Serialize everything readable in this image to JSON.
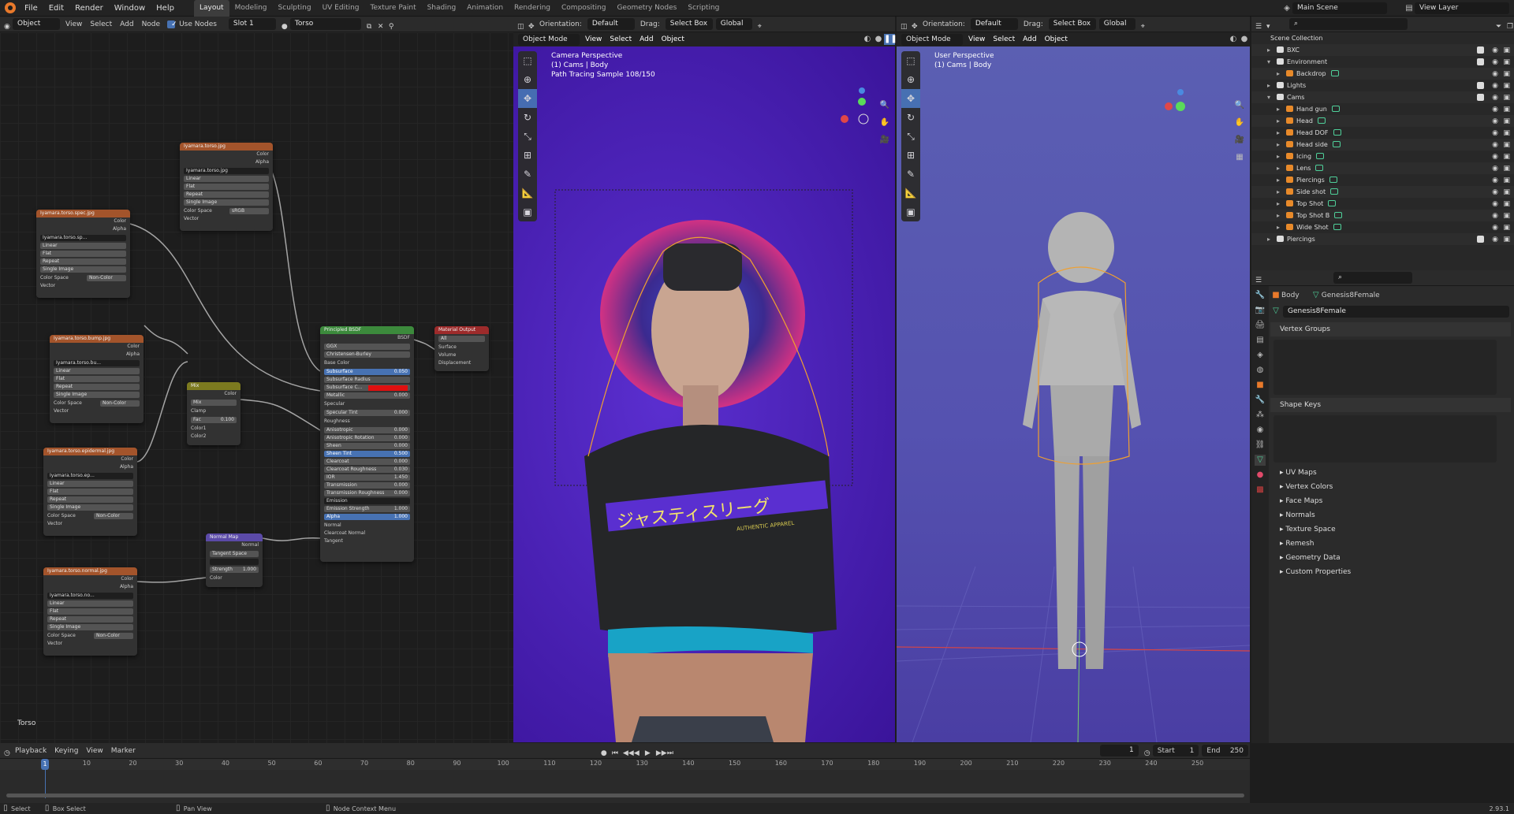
{
  "topbar": {
    "menus": [
      "File",
      "Edit",
      "Render",
      "Window",
      "Help"
    ],
    "workspaces": [
      "Layout",
      "Modeling",
      "Sculpting",
      "UV Editing",
      "Texture Paint",
      "Shading",
      "Animation",
      "Rendering",
      "Compositing",
      "Geometry Nodes",
      "Scripting"
    ],
    "active_ws": "Layout",
    "scene": "Main Scene",
    "view_layer": "View Layer"
  },
  "nodeheader": {
    "mode": "Object",
    "menus": [
      "View",
      "Select",
      "Add",
      "Node"
    ],
    "use_nodes": "Use Nodes",
    "slot": "Slot 1",
    "material": "Torso"
  },
  "nodes": {
    "tex_torso": {
      "title": "Iyamara.torso.jpg",
      "img": "Iyamara.torso.jpg",
      "interp": "Linear",
      "proj": "Flat",
      "ext": "Repeat",
      "src": "Single Image",
      "cs_label": "Color Space",
      "cs": "sRGB",
      "out_color": "Color",
      "out_alpha": "Alpha",
      "in_vec": "Vector"
    },
    "tex_spec": {
      "title": "Iyamara.torso.spec.jpg",
      "img": "Iyamara.torso.sp...",
      "interp": "Linear",
      "proj": "Flat",
      "ext": "Repeat",
      "src": "Single Image",
      "cs_label": "Color Space",
      "cs": "Non-Color",
      "out_color": "Color",
      "out_alpha": "Alpha",
      "in_vec": "Vector"
    },
    "tex_bump": {
      "title": "Iyamara.torso.bump.jpg",
      "img": "Iyamara.torso.bu...",
      "interp": "Linear",
      "proj": "Flat",
      "ext": "Repeat",
      "src": "Single Image",
      "cs_label": "Color Space",
      "cs": "Non-Color",
      "out_color": "Color",
      "out_alpha": "Alpha",
      "in_vec": "Vector"
    },
    "tex_epi": {
      "title": "Iyamara.torso.epidermal.jpg",
      "img": "Iyamara.torso.ep...",
      "interp": "Linear",
      "proj": "Flat",
      "ext": "Repeat",
      "src": "Single Image",
      "cs_label": "Color Space",
      "cs": "Non-Color",
      "out_color": "Color",
      "out_alpha": "Alpha",
      "in_vec": "Vector"
    },
    "tex_normal": {
      "title": "Iyamara.torso.normal.jpg",
      "img": "Iyamara.torso.no...",
      "interp": "Linear",
      "proj": "Flat",
      "ext": "Repeat",
      "src": "Single Image",
      "cs_label": "Color Space",
      "cs": "Non-Color",
      "out_color": "Color",
      "out_alpha": "Alpha",
      "in_vec": "Vector"
    },
    "mix": {
      "title": "Mix",
      "out": "Color",
      "mode": "Mix",
      "clamp": "Clamp",
      "fac": "Fac",
      "fac_val": "0.100",
      "c1": "Color1",
      "c2": "Color2"
    },
    "normalmap": {
      "title": "Normal Map",
      "out": "Normal",
      "space": "Tangent Space",
      "strength": "Strength",
      "strength_val": "1.000",
      "color": "Color"
    },
    "bsdf": {
      "title": "Principled BSDF",
      "out": "BSDF",
      "dist": "GGX",
      "sss": "Christensen-Burley",
      "rows": [
        [
          "Base Color",
          ""
        ],
        [
          "Subsurface",
          "0.050"
        ],
        [
          "Subsurface Radius",
          ""
        ],
        [
          "Subsurface C...",
          ""
        ],
        [
          "Metallic",
          "0.000"
        ],
        [
          "Specular",
          ""
        ],
        [
          "Specular Tint",
          "0.000"
        ],
        [
          "Roughness",
          ""
        ],
        [
          "Anisotropic",
          "0.000"
        ],
        [
          "Anisotropic Rotation",
          "0.000"
        ],
        [
          "Sheen",
          "0.000"
        ],
        [
          "Sheen Tint",
          "0.500"
        ],
        [
          "Clearcoat",
          "0.000"
        ],
        [
          "Clearcoat Roughness",
          "0.030"
        ],
        [
          "IOR",
          "1.450"
        ],
        [
          "Transmission",
          "0.000"
        ],
        [
          "Transmission Roughness",
          "0.000"
        ],
        [
          "Emission",
          ""
        ],
        [
          "Emission Strength",
          "1.000"
        ],
        [
          "Alpha",
          "1.000"
        ],
        [
          "Normal",
          ""
        ],
        [
          "Clearcoat Normal",
          ""
        ],
        [
          "Tangent",
          ""
        ]
      ]
    },
    "out": {
      "title": "Material Output",
      "target": "All",
      "surface": "Surface",
      "volume": "Volume",
      "disp": "Displacement"
    }
  },
  "node_label": "Torso",
  "vp1": {
    "mode": "Object Mode",
    "menus": [
      "View",
      "Select",
      "Add",
      "Object"
    ],
    "orientation_label": "Orientation:",
    "orientation": "Default",
    "drag_label": "Drag:",
    "drag": "Select Box",
    "transform": "Global",
    "line1": "Camera Perspective",
    "line2": "(1) Cams | Body",
    "line3": "Path Tracing Sample 108/150",
    "shirt_text": "ジャスティスリーグ",
    "shirt_sub": "AUTHENTIC APPAREL"
  },
  "vp2": {
    "mode": "Object Mode",
    "menus": [
      "View",
      "Select",
      "Add",
      "Object"
    ],
    "orientation_label": "Orientation:",
    "orientation": "Default",
    "drag_label": "Drag:",
    "drag": "Select Box",
    "transform": "Global",
    "line1": "User Perspective",
    "line2": "(1) Cams | Body"
  },
  "outliner": {
    "root": "Scene Collection",
    "items": [
      {
        "label": "BXC",
        "indent": 1,
        "arrow": "▸"
      },
      {
        "label": "Environment",
        "indent": 1,
        "arrow": "▾"
      },
      {
        "label": "Backdrop",
        "indent": 2,
        "arrow": "▸"
      },
      {
        "label": "Lights",
        "indent": 1,
        "arrow": "▸"
      },
      {
        "label": "Cams",
        "indent": 1,
        "arrow": "▾"
      },
      {
        "label": "Hand gun",
        "indent": 2,
        "arrow": "▸"
      },
      {
        "label": "Head",
        "indent": 2,
        "arrow": "▸"
      },
      {
        "label": "Head DOF",
        "indent": 2,
        "arrow": "▸"
      },
      {
        "label": "Head side",
        "indent": 2,
        "arrow": "▸"
      },
      {
        "label": "Icing",
        "indent": 2,
        "arrow": "▸"
      },
      {
        "label": "Lens",
        "indent": 2,
        "arrow": "▸"
      },
      {
        "label": "Piercings",
        "indent": 2,
        "arrow": "▸"
      },
      {
        "label": "Side shot",
        "indent": 2,
        "arrow": "▸"
      },
      {
        "label": "Top Shot",
        "indent": 2,
        "arrow": "▸"
      },
      {
        "label": "Top Shot B",
        "indent": 2,
        "arrow": "▸"
      },
      {
        "label": "Wide Shot",
        "indent": 2,
        "arrow": "▸"
      },
      {
        "label": "Piercings",
        "indent": 1,
        "arrow": "▸"
      }
    ]
  },
  "props": {
    "object": "Body",
    "data": "Genesis8Female",
    "mesh": "Genesis8Female",
    "vgroups": "Vertex Groups",
    "shapekeys": "Shape Keys",
    "sections": [
      "UV Maps",
      "Vertex Colors",
      "Face Maps",
      "Normals",
      "Texture Space",
      "Remesh",
      "Geometry Data",
      "Custom Properties"
    ]
  },
  "timeline": {
    "menus": [
      "Playback",
      "Keying",
      "View",
      "Marker"
    ],
    "frame": "1",
    "start_label": "Start",
    "start": "1",
    "end_label": "End",
    "end": "250",
    "ticks": [
      "1",
      "10",
      "20",
      "30",
      "40",
      "50",
      "60",
      "70",
      "80",
      "90",
      "100",
      "110",
      "120",
      "130",
      "140",
      "150",
      "160",
      "170",
      "180",
      "190",
      "200",
      "210",
      "220",
      "230",
      "240",
      "250"
    ]
  },
  "status": {
    "select": "Select",
    "box": "Box Select",
    "pan": "Pan View",
    "ctx": "Node Context Menu",
    "version": "2.93.1"
  }
}
